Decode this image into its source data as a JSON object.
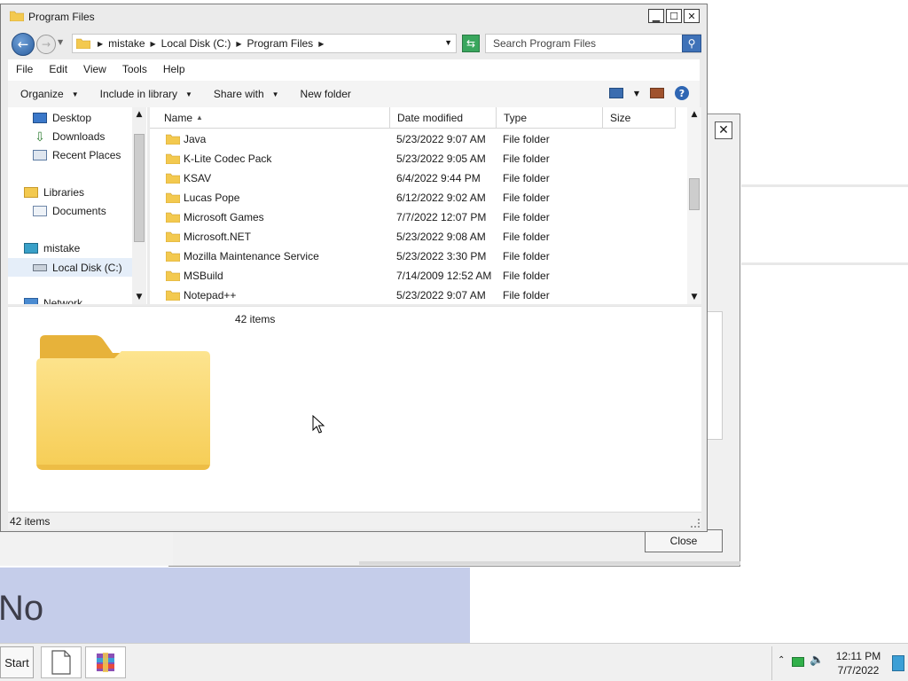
{
  "window": {
    "title": "Program Files",
    "address": {
      "crumbs": [
        "mistake",
        "Local Disk (C:)",
        "Program Files"
      ]
    },
    "search": {
      "placeholder": "Search Program Files"
    },
    "menu": [
      "File",
      "Edit",
      "View",
      "Tools",
      "Help"
    ],
    "toolbar": {
      "organize": "Organize",
      "include_in_library": "Include in library",
      "share_with": "Share with",
      "new_folder": "New folder"
    },
    "nav": [
      {
        "label": "Desktop",
        "icon": "desktop-icon"
      },
      {
        "label": "Downloads",
        "icon": "downloads-icon"
      },
      {
        "label": "Recent Places",
        "icon": "recent-places-icon"
      },
      {
        "label": "Libraries",
        "icon": "libraries-icon"
      },
      {
        "label": "Documents",
        "icon": "documents-icon"
      },
      {
        "label": "mistake",
        "icon": "computer-icon"
      },
      {
        "label": "Local Disk (C:)",
        "icon": "drive-icon"
      },
      {
        "label": "Network",
        "icon": "network-icon"
      }
    ],
    "columns": [
      "Name",
      "Date modified",
      "Type",
      "Size"
    ],
    "rows": [
      {
        "name": "Java",
        "date": "5/23/2022 9:07 AM",
        "type": "File folder"
      },
      {
        "name": "K-Lite Codec Pack",
        "date": "5/23/2022 9:05 AM",
        "type": "File folder"
      },
      {
        "name": "KSAV",
        "date": "6/4/2022 9:44 PM",
        "type": "File folder"
      },
      {
        "name": "Lucas Pope",
        "date": "6/12/2022 9:02 AM",
        "type": "File folder"
      },
      {
        "name": "Microsoft Games",
        "date": "7/7/2022 12:07 PM",
        "type": "File folder"
      },
      {
        "name": "Microsoft.NET",
        "date": "5/23/2022 9:08 AM",
        "type": "File folder"
      },
      {
        "name": "Mozilla Maintenance Service",
        "date": "5/23/2022 3:30 PM",
        "type": "File folder"
      },
      {
        "name": "MSBuild",
        "date": "7/14/2009 12:52 AM",
        "type": "File folder"
      },
      {
        "name": "Notepad++",
        "date": "5/23/2022 9:07 AM",
        "type": "File folder"
      }
    ],
    "details_count": "42 items",
    "status": "42 items"
  },
  "background": {
    "close_button": "Close",
    "text_no": "No"
  },
  "taskbar": {
    "start": "Start",
    "time": "12:11 PM",
    "date": "7/7/2022"
  },
  "colors": {
    "folder": "#f3c94f",
    "accent": "#2f66b3",
    "selection": "#e5eef9"
  }
}
